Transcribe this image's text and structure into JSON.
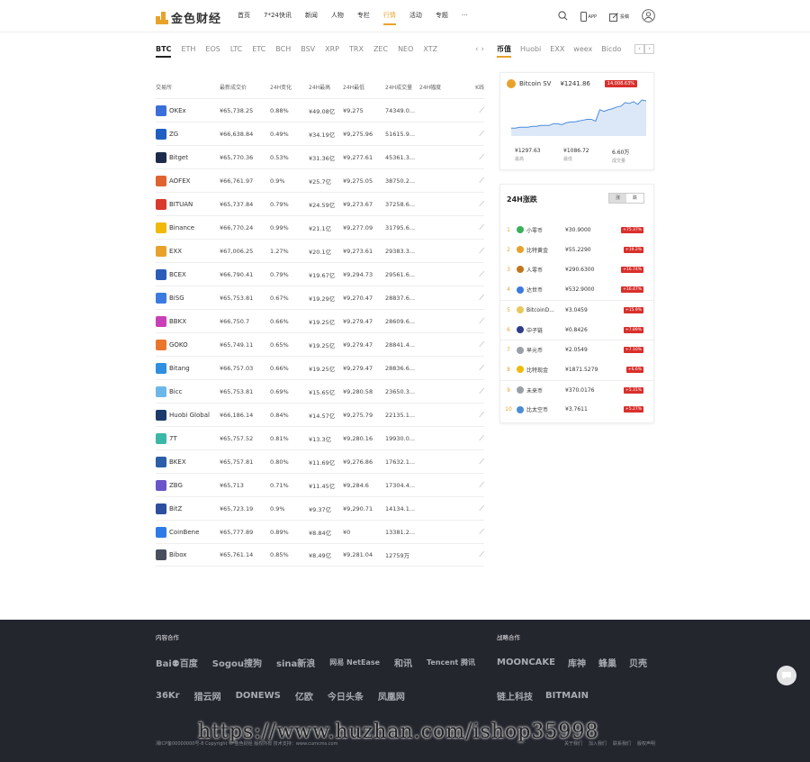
{
  "header": {
    "logo_text": "金色财经",
    "nav": [
      "首页",
      "7*24快讯",
      "新闻",
      "人物",
      "专栏",
      "行情",
      "活动",
      "专题",
      "···"
    ],
    "active_nav": 5,
    "app_label": "APP",
    "write_label": "投稿"
  },
  "coin_tabs": [
    "BTC",
    "ETH",
    "EOS",
    "LTC",
    "ETC",
    "BCH",
    "BSV",
    "XRP",
    "TRX",
    "ZEC",
    "NEO",
    "XTZ"
  ],
  "table": {
    "headers": [
      "交易所",
      "最新成交价",
      "24H变化",
      "24H最高",
      "24H最低",
      "24H成交量",
      "24H幅度",
      "K线"
    ],
    "rows": [
      {
        "name": "OKEx",
        "price": "¥65,738.25",
        "chg": "0.88%",
        "high": "¥49.08亿",
        "low": "¥9,275",
        "vol": "74349.0...",
        "color": "#3a6fd9"
      },
      {
        "name": "ZG",
        "price": "¥66,638.84",
        "chg": "0.49%",
        "high": "¥34.19亿",
        "low": "¥9,275.96",
        "vol": "51615.9...",
        "color": "#1f5fc1"
      },
      {
        "name": "Bitget",
        "price": "¥65,770.36",
        "chg": "0.53%",
        "high": "¥31.36亿",
        "low": "¥9,277.61",
        "vol": "45361.3...",
        "color": "#1d2c4c"
      },
      {
        "name": "AOFEX",
        "price": "¥66,761.97",
        "chg": "0.9%",
        "high": "¥25.7亿",
        "low": "¥9,275.05",
        "vol": "38750.2...",
        "color": "#e0622f"
      },
      {
        "name": "BITUAN",
        "price": "¥65,737.84",
        "chg": "0.79%",
        "high": "¥24.59亿",
        "low": "¥9,273.67",
        "vol": "37258.6...",
        "color": "#d93a2c"
      },
      {
        "name": "Binance",
        "price": "¥66,770.24",
        "chg": "0.99%",
        "high": "¥21.1亿",
        "low": "¥9,277.09",
        "vol": "31795.6...",
        "color": "#f0b90b"
      },
      {
        "name": "EXX",
        "price": "¥67,006.25",
        "chg": "1.27%",
        "high": "¥20.1亿",
        "low": "¥9,273.61",
        "vol": "29383.3...",
        "color": "#e8a22a"
      },
      {
        "name": "BCEX",
        "price": "¥66,790.41",
        "chg": "0.79%",
        "high": "¥19.67亿",
        "low": "¥9,294.73",
        "vol": "29561.6...",
        "color": "#2b5db8"
      },
      {
        "name": "BiSG",
        "price": "¥65,753.81",
        "chg": "0.67%",
        "high": "¥19.29亿",
        "low": "¥9,270.47",
        "vol": "28837.6...",
        "color": "#3b7be0"
      },
      {
        "name": "BBKX",
        "price": "¥66,750.7",
        "chg": "0.66%",
        "high": "¥19.25亿",
        "low": "¥9,279.47",
        "vol": "28609.6...",
        "color": "#c93fb8"
      },
      {
        "name": "GOKO",
        "price": "¥65,749.11",
        "chg": "0.65%",
        "high": "¥19.25亿",
        "low": "¥9,279.47",
        "vol": "28841.4...",
        "color": "#e9762b"
      },
      {
        "name": "Bitang",
        "price": "¥66,757.03",
        "chg": "0.66%",
        "high": "¥19.25亿",
        "low": "¥9,279.47",
        "vol": "28836.6...",
        "color": "#2f8fe0"
      },
      {
        "name": "Bicc",
        "price": "¥65,753.81",
        "chg": "0.69%",
        "high": "¥15.65亿",
        "low": "¥9,280.58",
        "vol": "23650.3...",
        "color": "#6cb7ea"
      },
      {
        "name": "Huobi Global",
        "price": "¥66,186.14",
        "chg": "0.84%",
        "high": "¥14.57亿",
        "low": "¥9,275.79",
        "vol": "22135.1...",
        "color": "#1c3a6b"
      },
      {
        "name": "7T",
        "price": "¥65,757.52",
        "chg": "0.81%",
        "high": "¥13.3亿",
        "low": "¥9,280.16",
        "vol": "19930.0...",
        "color": "#3bb7a7"
      },
      {
        "name": "BKEX",
        "price": "¥65,757.81",
        "chg": "0.80%",
        "high": "¥11.69亿",
        "low": "¥9,276.86",
        "vol": "17632.1...",
        "color": "#2d5ea8"
      },
      {
        "name": "ZBG",
        "price": "¥65,713",
        "chg": "0.71%",
        "high": "¥11.45亿",
        "low": "¥9,284.6",
        "vol": "17304.4...",
        "color": "#6a56c8"
      },
      {
        "name": "BitZ",
        "price": "¥65,723.19",
        "chg": "0.9%",
        "high": "¥9.37亿",
        "low": "¥9,290.71",
        "vol": "14134.1...",
        "color": "#2d4fa0"
      },
      {
        "name": "CoinBene",
        "price": "¥65,777.89",
        "chg": "0.89%",
        "high": "¥8.84亿",
        "low": "¥0",
        "vol": "13381.2...",
        "color": "#2e7be8"
      },
      {
        "name": "Bibox",
        "price": "¥65,761.14",
        "chg": "0.85%",
        "high": "¥8.49亿",
        "low": "¥9,281.04",
        "vol": "12759万",
        "color": "#4a4f5e"
      }
    ]
  },
  "right_tabs": [
    "币值",
    "Huobi",
    "EXX",
    "weex",
    "Bicdo"
  ],
  "coin_card": {
    "name": "Bitcoin SV",
    "price": "¥1241.86",
    "badge": "14,008.63%",
    "stats": [
      {
        "value": "¥1297.63",
        "label": "最高"
      },
      {
        "value": "¥1086.72",
        "label": "最低"
      },
      {
        "value": "6.60万",
        "label": "成交量"
      }
    ],
    "chart_values": [
      9,
      9,
      10,
      10,
      10,
      11,
      11,
      12,
      12,
      12,
      14,
      14,
      13,
      15,
      16,
      16,
      17,
      18,
      19,
      19,
      17,
      30,
      28,
      30,
      31,
      33,
      34,
      38,
      37,
      39,
      36,
      41,
      40
    ]
  },
  "rank_card": {
    "title": "24H涨跌",
    "toggle": [
      "涨",
      "跌"
    ],
    "rows": [
      {
        "n": "1",
        "name": "小零币",
        "price": "¥30.9000",
        "chg": "+75.37%",
        "color": "#3bb05a"
      },
      {
        "n": "2",
        "name": "比特黄金",
        "price": "¥55.2290",
        "chg": "+19.2%",
        "color": "#e8a22a"
      },
      {
        "n": "3",
        "name": "人零币",
        "price": "¥290.6300",
        "chg": "+16.74%",
        "color": "#c2761b"
      },
      {
        "n": "4",
        "name": "达世币",
        "price": "¥532.9000",
        "chg": "+16.47%",
        "color": "#3a7be0"
      },
      {
        "n": "5",
        "name": "BitcoinD...",
        "price": "¥3.0459",
        "chg": "+15.9%",
        "color": "#e8c75a"
      },
      {
        "n": "6",
        "name": "中子链",
        "price": "¥0.8426",
        "chg": "+7.89%",
        "color": "#2d3c88"
      },
      {
        "n": "7",
        "name": "早元币",
        "price": "¥2.0549",
        "chg": "+7.10%",
        "color": "#9aa0a8"
      },
      {
        "n": "8",
        "name": "比特现金",
        "price": "¥1871.5279",
        "chg": "+6.6%",
        "color": "#f0b90b"
      },
      {
        "n": "9",
        "name": "未来币",
        "price": "¥370.0176",
        "chg": "+5.31%",
        "color": "#9aa0a8"
      },
      {
        "n": "10",
        "name": "比太空币",
        "price": "¥3.7611",
        "chg": "+5.27%",
        "color": "#4a8cd6"
      }
    ]
  },
  "footer": {
    "content_title": "内容合作",
    "strategic_title": "战略合作",
    "content_partners": [
      "Bai⚉百度",
      "Sogou搜狗",
      "sina新浪",
      "网易 NetEase",
      "和讯",
      "Tencent 腾讯",
      "36Kr",
      "猎云网",
      "DONEWS",
      "亿欧",
      "今日头条",
      "凤凰网"
    ],
    "strategic_partners": [
      "MOONCAKE",
      "库神",
      "蜂巢",
      "贝壳",
      "链上科技",
      "BITMAIN"
    ],
    "copyright": "湘ICP备00000000号-8   Copyright © 金色财经 版权所有   技术支持：www.cumcms.com",
    "links": [
      "关于我们",
      "加入我们",
      "联系我们",
      "版权声明"
    ]
  },
  "watermark": "https://www.huzhan.com/ishop35998"
}
